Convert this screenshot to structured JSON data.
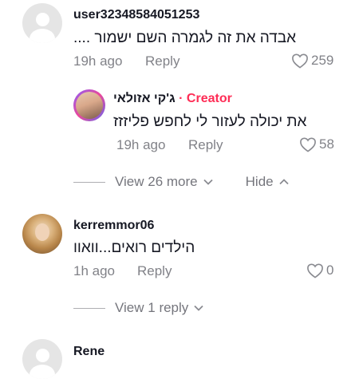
{
  "comments": [
    {
      "username": "user32348584051253",
      "text": "אבדה את זה לגמרה השם ישמור ....",
      "time": "19h ago",
      "reply_label": "Reply",
      "likes": "259"
    },
    {
      "username": "kerremmor06",
      "text": "הילדים רואים...וואוו",
      "time": "1h ago",
      "reply_label": "Reply",
      "likes": "0"
    },
    {
      "username": "Rene"
    }
  ],
  "reply": {
    "username": "ג'קי אזולאי",
    "creator_label": "· Creator",
    "text": "את יכולה לעזור לי לחפש פליזזז",
    "time": "19h ago",
    "reply_label": "Reply",
    "likes": "58"
  },
  "thread_controls": {
    "view_more": "View 26 more",
    "hide": "Hide",
    "view_reply": "View 1 reply"
  },
  "colors": {
    "creator": "#fe2c55",
    "muted_text": "#8a8b91"
  },
  "icons": [
    "heart-outline-icon",
    "chevron-down-icon",
    "chevron-up-icon",
    "default-avatar-icon"
  ]
}
